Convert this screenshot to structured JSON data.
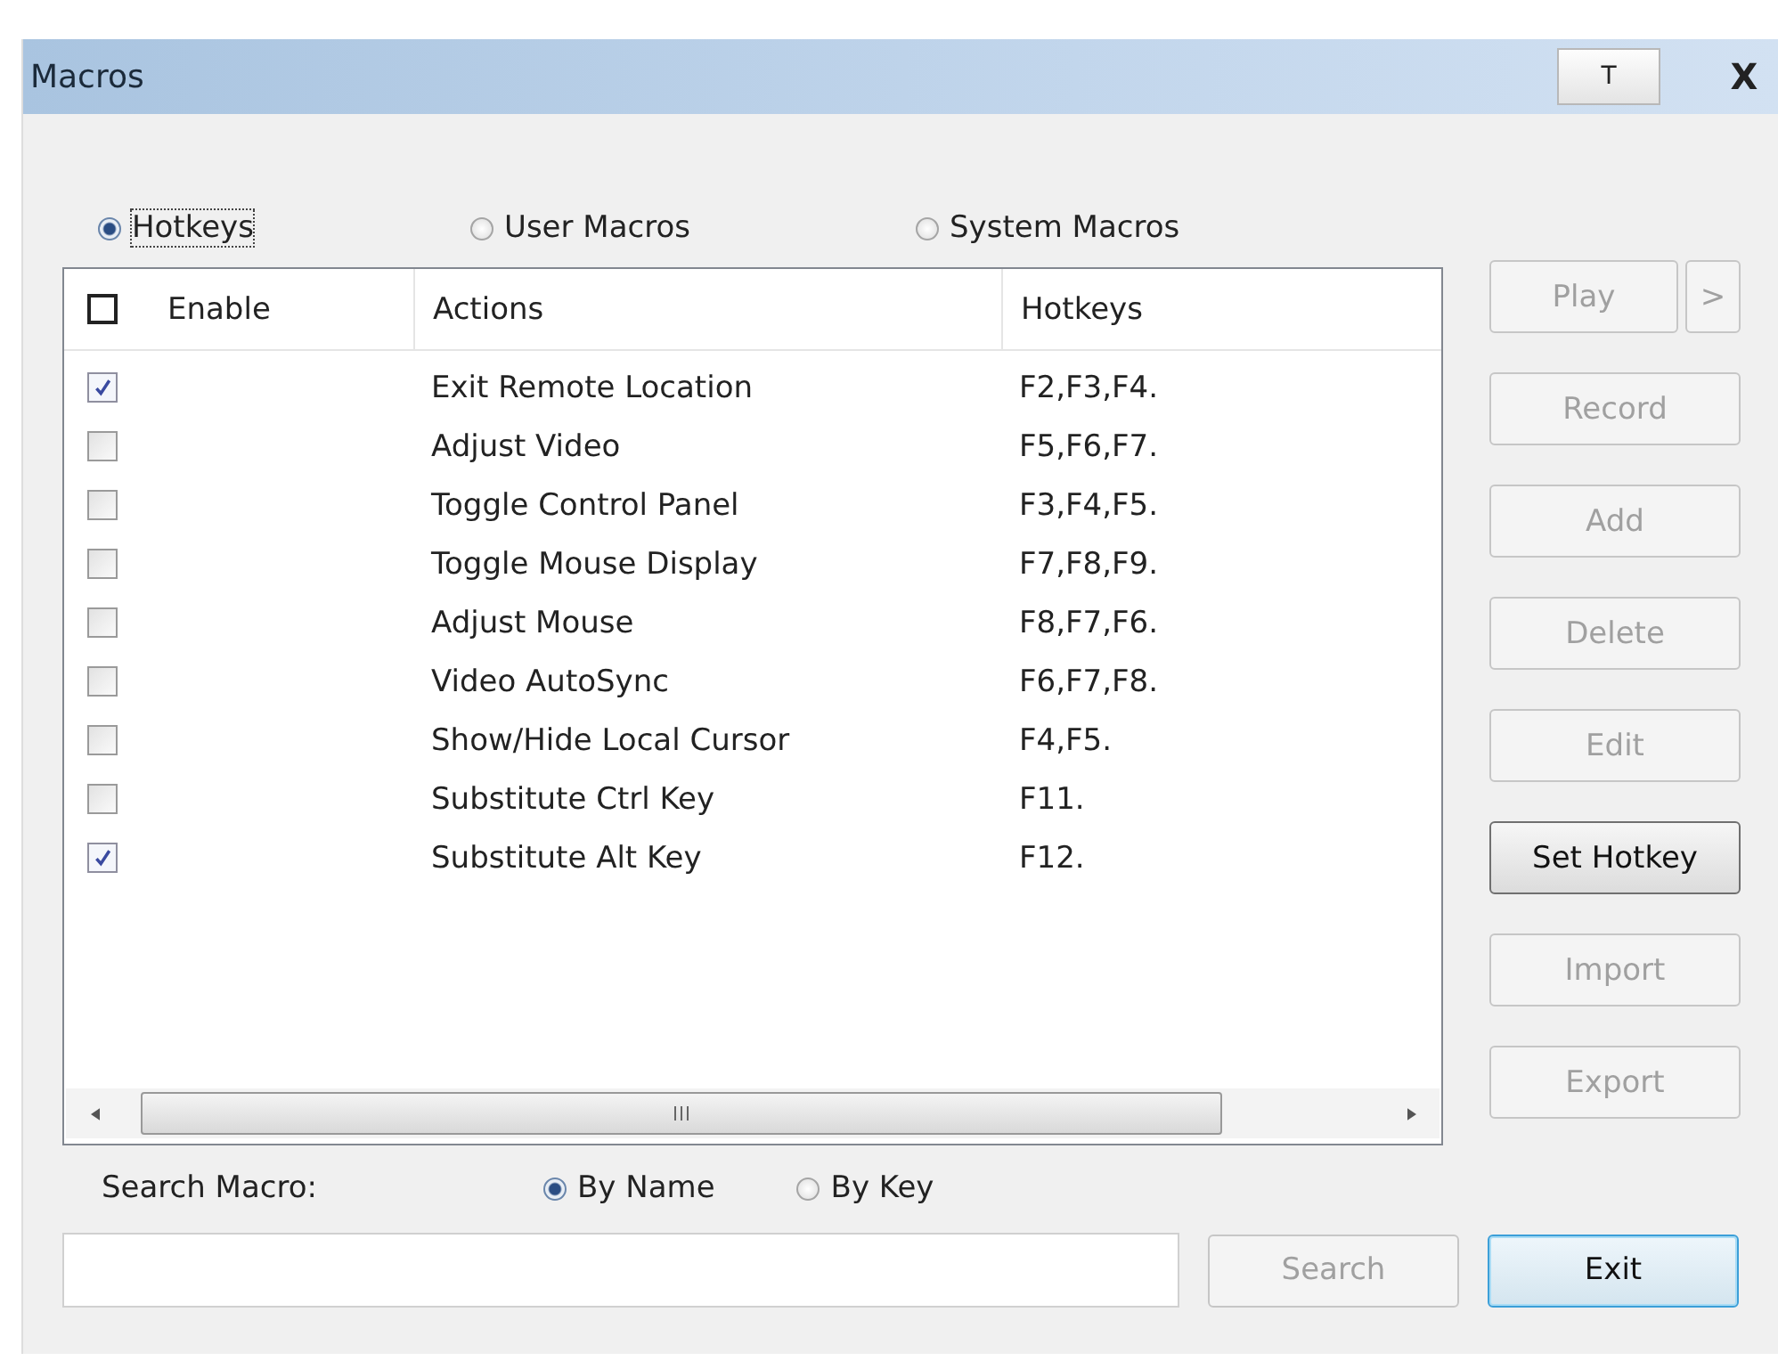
{
  "window": {
    "title": "Macros",
    "title_buttons": [
      {
        "label": "T",
        "kind": "pin"
      },
      {
        "label": "X",
        "kind": "close"
      }
    ]
  },
  "modes": [
    {
      "label": "Hotkeys",
      "selected": true,
      "focused": true
    },
    {
      "label": "User Macros",
      "selected": false,
      "focused": false
    },
    {
      "label": "System Macros",
      "selected": false,
      "focused": false
    }
  ],
  "table": {
    "header_checked": false,
    "columns": [
      "Enable",
      "Actions",
      "Hotkeys"
    ],
    "rows": [
      {
        "enabled": true,
        "action": "Exit Remote Location",
        "hotkey": "F2,F3,F4."
      },
      {
        "enabled": false,
        "action": "Adjust Video",
        "hotkey": "F5,F6,F7."
      },
      {
        "enabled": false,
        "action": "Toggle Control Panel",
        "hotkey": "F3,F4,F5."
      },
      {
        "enabled": false,
        "action": "Toggle Mouse Display",
        "hotkey": "F7,F8,F9."
      },
      {
        "enabled": false,
        "action": "Adjust Mouse",
        "hotkey": "F8,F7,F6."
      },
      {
        "enabled": false,
        "action": "Video AutoSync",
        "hotkey": "F6,F7,F8."
      },
      {
        "enabled": false,
        "action": "Show/Hide Local Cursor",
        "hotkey": "F4,F5."
      },
      {
        "enabled": false,
        "action": "Substitute Ctrl Key",
        "hotkey": "F11."
      },
      {
        "enabled": true,
        "action": "Substitute Alt Key",
        "hotkey": "F12."
      }
    ]
  },
  "side_buttons": [
    {
      "label": "Play",
      "disabled": true,
      "extra": ">"
    },
    {
      "label": "Record",
      "disabled": true
    },
    {
      "label": "Add",
      "disabled": true
    },
    {
      "label": "Delete",
      "disabled": true
    },
    {
      "label": "Edit",
      "disabled": true
    },
    {
      "label": "Set Hotkey",
      "disabled": false
    },
    {
      "label": "Import",
      "disabled": true
    },
    {
      "label": "Export",
      "disabled": true
    }
  ],
  "search": {
    "label": "Search Macro:",
    "options": [
      {
        "label": "By Name",
        "selected": true
      },
      {
        "label": "By Key",
        "selected": false
      }
    ],
    "button": {
      "label": "Search",
      "disabled": true
    }
  },
  "exit_button": {
    "label": "Exit",
    "focused": true
  }
}
